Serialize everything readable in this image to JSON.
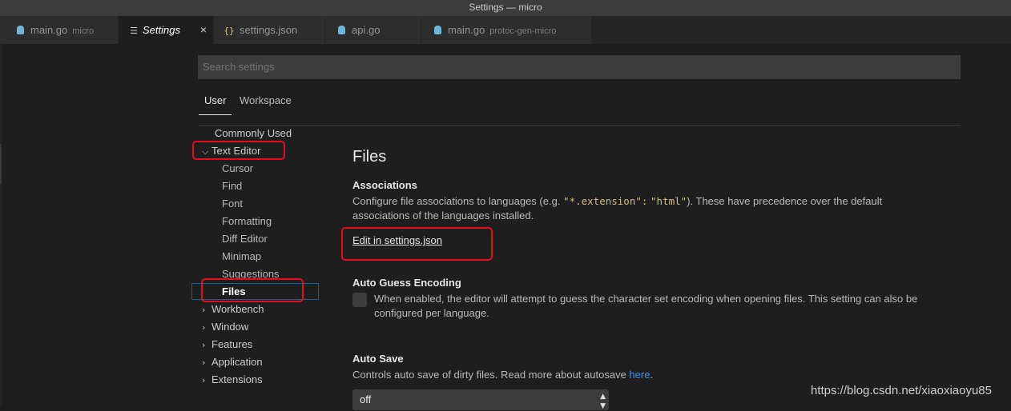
{
  "window": {
    "title": "Settings — micro"
  },
  "tabs": [
    {
      "label": "main.go",
      "desc": "micro",
      "icon": "go-gopher-icon"
    },
    {
      "label": "Settings",
      "desc": "",
      "icon": "menu-lines-icon",
      "active": true,
      "close": "×"
    },
    {
      "label": "settings.json",
      "desc": "",
      "icon": "json-braces-icon",
      "glyph": "{}"
    },
    {
      "label": "api.go",
      "desc": "",
      "icon": "go-gopher-icon"
    },
    {
      "label": "main.go",
      "desc": "protoc-gen-micro",
      "icon": "go-gopher-icon"
    }
  ],
  "search": {
    "placeholder": "Search settings"
  },
  "scope_tabs": {
    "user": "User",
    "workspace": "Workspace"
  },
  "toc": {
    "commonly_used": "Commonly Used",
    "text_editor": "Text Editor",
    "text_editor_children": [
      "Cursor",
      "Find",
      "Font",
      "Formatting",
      "Diff Editor",
      "Minimap",
      "Suggestions",
      "Files"
    ],
    "collapsed": [
      "Workbench",
      "Window",
      "Features",
      "Application",
      "Extensions"
    ]
  },
  "main": {
    "section_title": "Files",
    "associations": {
      "title": "Associations",
      "desc_before": "Configure file associations to languages (e.g. ",
      "code_key": "\"*.extension\":",
      "code_val": "\"html\"",
      "desc_after": "). These have precedence over the default",
      "desc_line2": "associations of the languages installed.",
      "edit_link": "Edit in settings.json"
    },
    "auto_guess": {
      "title": "Auto Guess Encoding",
      "desc_line1": "When enabled, the editor will attempt to guess the character set encoding when opening files. This setting can also be",
      "desc_line2": "configured per language.",
      "checked": false
    },
    "auto_save": {
      "title": "Auto Save",
      "desc": "Controls auto save of dirty files. Read more about autosave ",
      "link": "here",
      "period": ".",
      "value": "off"
    }
  },
  "watermark": "https://blog.csdn.net/xiaoxiaoyu85",
  "colors": {
    "background": "#1e1e1e",
    "tabbar": "#252526",
    "input": "#3c3c3c",
    "link": "#3794ff",
    "highlight_box": "#e0101b",
    "focus_border": "#0e639c"
  }
}
